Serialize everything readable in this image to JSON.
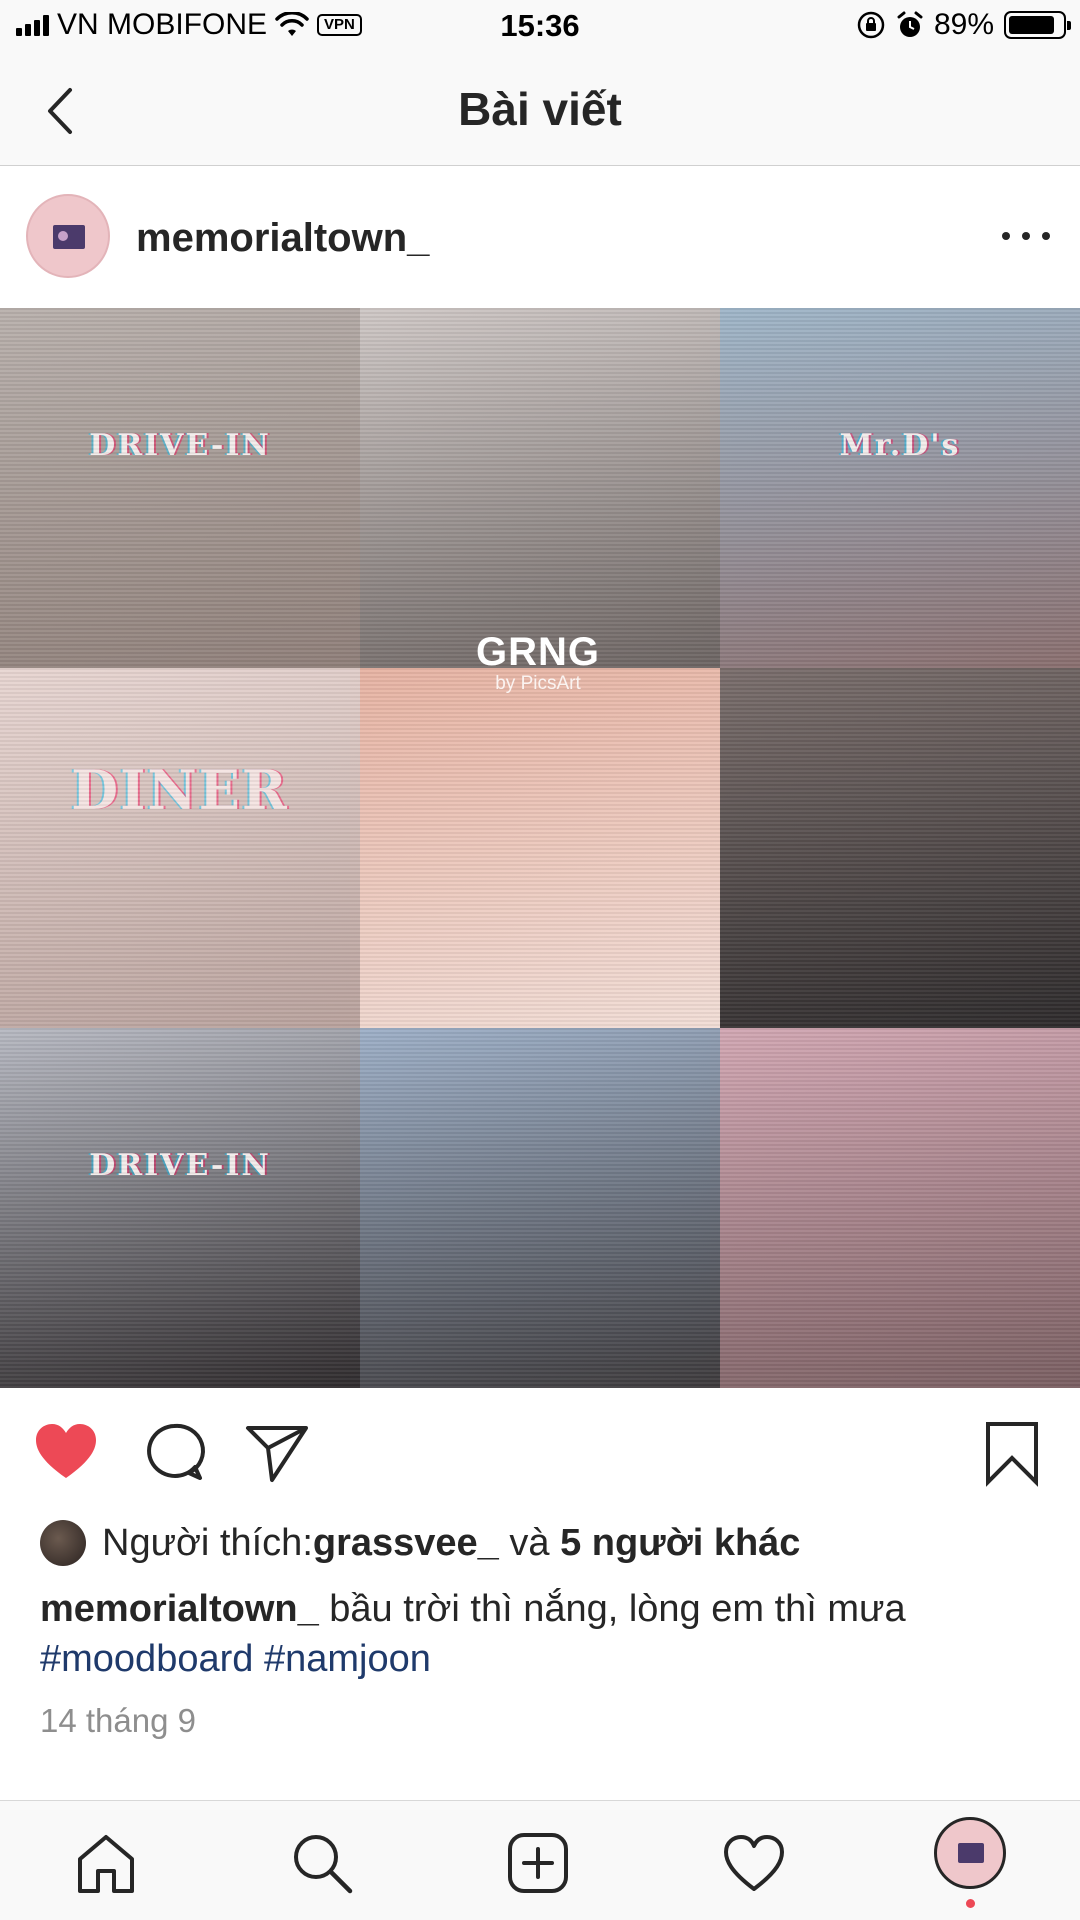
{
  "status_bar": {
    "carrier": "VN MOBIFONE",
    "vpn_label": "VPN",
    "time": "15:36",
    "battery_percent": "89%",
    "battery_level": 0.89
  },
  "nav": {
    "title": "Bài viết",
    "back_icon": "chevron-left-icon"
  },
  "post": {
    "username": "memorialtown_",
    "more_icon": "more-horizontal-icon",
    "image": {
      "tiles": [
        {
          "caption": "DRIVE-IN",
          "palette": [
            "#b9b1ad",
            "#8f7f79"
          ]
        },
        {
          "caption": "",
          "palette": [
            "#cfc8c6",
            "#6c6462"
          ]
        },
        {
          "caption": "Mr.D's",
          "palette": [
            "#9fb6c9",
            "#8a6f6f"
          ]
        },
        {
          "caption": "DINER",
          "palette": [
            "#e8d6d2",
            "#b9a29d"
          ]
        },
        {
          "caption": "",
          "palette": [
            "#e7b3a3",
            "#f1ddd6"
          ]
        },
        {
          "caption": "",
          "palette": [
            "#7a6e6c",
            "#2d2a2b"
          ]
        },
        {
          "caption": "DRIVE-IN",
          "palette": [
            "#b7b9c2",
            "#2f2b2d"
          ]
        },
        {
          "caption": "",
          "palette": [
            "#9eb0c8",
            "#3d3a3c"
          ]
        },
        {
          "caption": "",
          "palette": [
            "#d2a7b3",
            "#7a5f62"
          ]
        }
      ],
      "watermark_main": "GRNG",
      "watermark_sub": "by PicsArt"
    },
    "actions": {
      "like_icon": "heart-filled-icon",
      "comment_icon": "comment-icon",
      "share_icon": "send-icon",
      "save_icon": "bookmark-icon",
      "liked": true,
      "like_color": "#ed4956"
    },
    "likes": {
      "prefix": "Người thích: ",
      "first_user": "grassvee_",
      "connector": " và ",
      "others": "5 người khác"
    },
    "caption": {
      "username": "memorialtown_",
      "text": " bầu trời thì nắng, lòng em thì mưa",
      "hashtags": [
        "#moodboard",
        "#namjoon"
      ]
    },
    "date": "14 tháng 9"
  },
  "tab_bar": {
    "items": [
      "home-icon",
      "search-icon",
      "add-post-icon",
      "activity-heart-icon",
      "profile-avatar"
    ],
    "notification_color": "#ed4956"
  },
  "colors": {
    "hashtag": "#1f3a6b",
    "text_primary": "#262626",
    "text_secondary": "#8e8e8e"
  }
}
